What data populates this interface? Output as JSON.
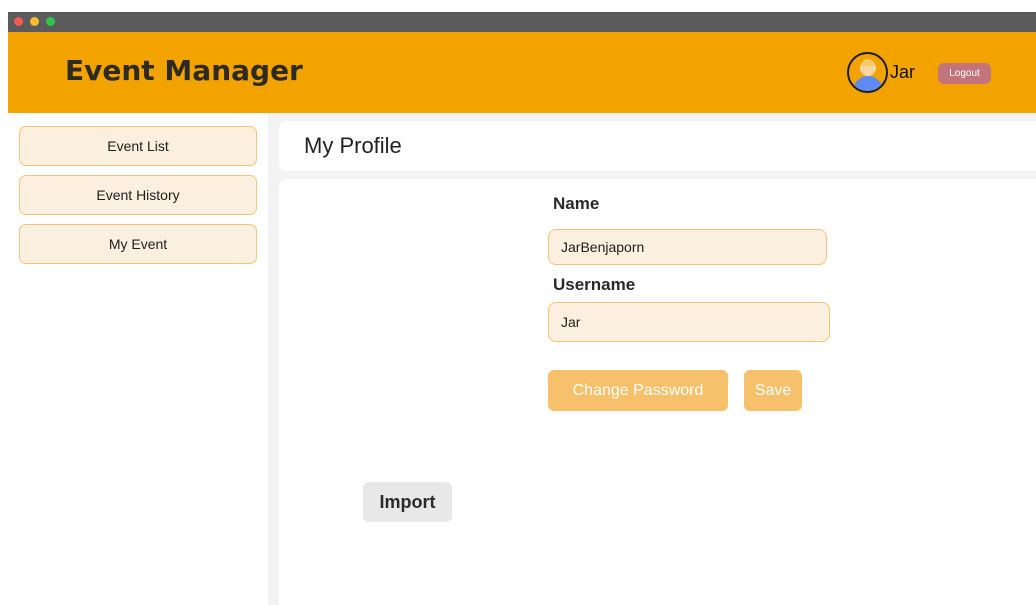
{
  "app": {
    "title": "Event Manager"
  },
  "user": {
    "name": "Jar",
    "avatar_icon": "user-avatar-icon"
  },
  "header": {
    "logout_label": "Logout"
  },
  "sidebar": {
    "items": [
      {
        "label": "Event List"
      },
      {
        "label": "Event History"
      },
      {
        "label": "My Event"
      }
    ]
  },
  "page": {
    "title": "My Profile"
  },
  "profile": {
    "name_label": "Name",
    "name_value": "JarBenjaporn",
    "username_label": "Username",
    "username_value": "Jar",
    "change_password_label": "Change Password",
    "save_label": "Save",
    "import_label": "Import"
  },
  "colors": {
    "header": "#f3a300",
    "accent_button": "#f7c06a",
    "logout": "#c3737a",
    "field_fill": "#fbf0df",
    "field_border": "#f5c577"
  }
}
